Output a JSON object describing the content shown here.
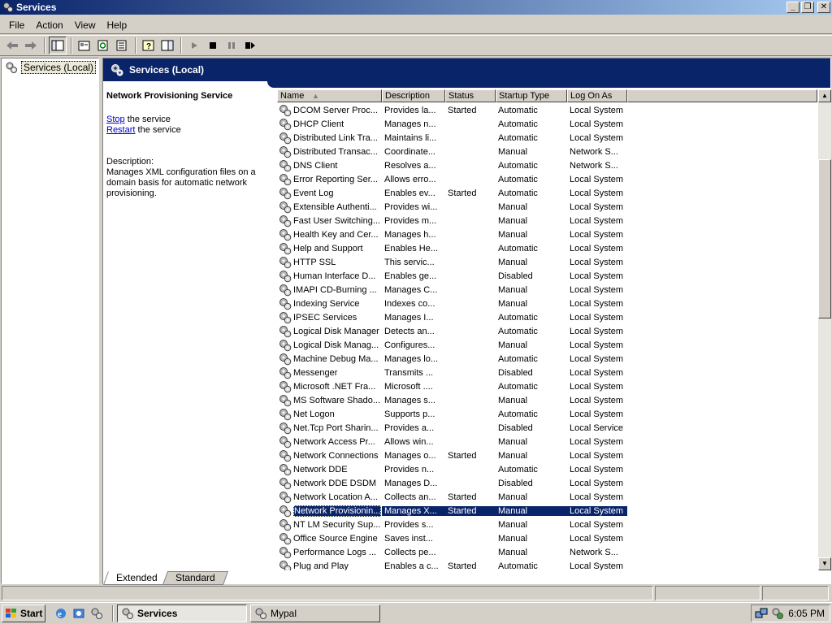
{
  "window": {
    "title": "Services"
  },
  "menu": [
    "File",
    "Action",
    "View",
    "Help"
  ],
  "tree": {
    "root": "Services (Local)"
  },
  "header": {
    "title": "Services (Local)"
  },
  "details": {
    "service_name": "Network Provisioning Service",
    "stop_link": "Stop",
    "stop_text": " the service",
    "restart_link": "Restart",
    "restart_text": " the service",
    "description_label": "Description:",
    "description": "Manages XML configuration files on a domain basis for automatic network provisioning."
  },
  "table": {
    "columns": [
      "Name",
      "Description",
      "Status",
      "Startup Type",
      "Log On As"
    ],
    "rows": [
      [
        "DCOM Server Proc...",
        "Provides la...",
        "Started",
        "Automatic",
        "Local System"
      ],
      [
        "DHCP Client",
        "Manages n...",
        "",
        "Automatic",
        "Local System"
      ],
      [
        "Distributed Link Tra...",
        "Maintains li...",
        "",
        "Automatic",
        "Local System"
      ],
      [
        "Distributed Transac...",
        "Coordinate...",
        "",
        "Manual",
        "Network S..."
      ],
      [
        "DNS Client",
        "Resolves a...",
        "",
        "Automatic",
        "Network S..."
      ],
      [
        "Error Reporting Ser...",
        "Allows erro...",
        "",
        "Automatic",
        "Local System"
      ],
      [
        "Event Log",
        "Enables ev...",
        "Started",
        "Automatic",
        "Local System"
      ],
      [
        "Extensible Authenti...",
        "Provides wi...",
        "",
        "Manual",
        "Local System"
      ],
      [
        "Fast User Switching...",
        "Provides m...",
        "",
        "Manual",
        "Local System"
      ],
      [
        "Health Key and Cer...",
        "Manages h...",
        "",
        "Manual",
        "Local System"
      ],
      [
        "Help and Support",
        "Enables He...",
        "",
        "Automatic",
        "Local System"
      ],
      [
        "HTTP SSL",
        "This servic...",
        "",
        "Manual",
        "Local System"
      ],
      [
        "Human Interface D...",
        "Enables ge...",
        "",
        "Disabled",
        "Local System"
      ],
      [
        "IMAPI CD-Burning ...",
        "Manages C...",
        "",
        "Manual",
        "Local System"
      ],
      [
        "Indexing Service",
        "Indexes co...",
        "",
        "Manual",
        "Local System"
      ],
      [
        "IPSEC Services",
        "Manages I...",
        "",
        "Automatic",
        "Local System"
      ],
      [
        "Logical Disk Manager",
        "Detects an...",
        "",
        "Automatic",
        "Local System"
      ],
      [
        "Logical Disk Manag...",
        "Configures...",
        "",
        "Manual",
        "Local System"
      ],
      [
        "Machine Debug Ma...",
        "Manages lo...",
        "",
        "Automatic",
        "Local System"
      ],
      [
        "Messenger",
        "Transmits ...",
        "",
        "Disabled",
        "Local System"
      ],
      [
        "Microsoft .NET Fra...",
        "Microsoft ....",
        "",
        "Automatic",
        "Local System"
      ],
      [
        "MS Software Shado...",
        "Manages s...",
        "",
        "Manual",
        "Local System"
      ],
      [
        "Net Logon",
        "Supports p...",
        "",
        "Automatic",
        "Local System"
      ],
      [
        "Net.Tcp Port Sharin...",
        "Provides a...",
        "",
        "Disabled",
        "Local Service"
      ],
      [
        "Network Access Pr...",
        "Allows win...",
        "",
        "Manual",
        "Local System"
      ],
      [
        "Network Connections",
        "Manages o...",
        "Started",
        "Manual",
        "Local System"
      ],
      [
        "Network DDE",
        "Provides n...",
        "",
        "Automatic",
        "Local System"
      ],
      [
        "Network DDE DSDM",
        "Manages D...",
        "",
        "Disabled",
        "Local System"
      ],
      [
        "Network Location A...",
        "Collects an...",
        "Started",
        "Manual",
        "Local System"
      ],
      [
        "Network Provisionin...",
        "Manages X...",
        "Started",
        "Manual",
        "Local System"
      ],
      [
        "NT LM Security Sup...",
        "Provides s...",
        "",
        "Manual",
        "Local System"
      ],
      [
        "Office Source Engine",
        "Saves inst...",
        "",
        "Manual",
        "Local System"
      ],
      [
        "Performance Logs ...",
        "Collects pe...",
        "",
        "Manual",
        "Network S..."
      ],
      [
        "Plug and Play",
        "Enables a c...",
        "Started",
        "Automatic",
        "Local System"
      ]
    ],
    "selected_row": 29
  },
  "tabs": [
    "Extended",
    "Standard"
  ],
  "taskbar": {
    "start": "Start",
    "tasks": [
      "Services",
      "Mypal"
    ],
    "clock": "6:05 PM"
  },
  "colors": {
    "selection": "#0a246a",
    "title_start": "#0a246a",
    "title_end": "#a6caf0",
    "link": "#0000c0"
  }
}
